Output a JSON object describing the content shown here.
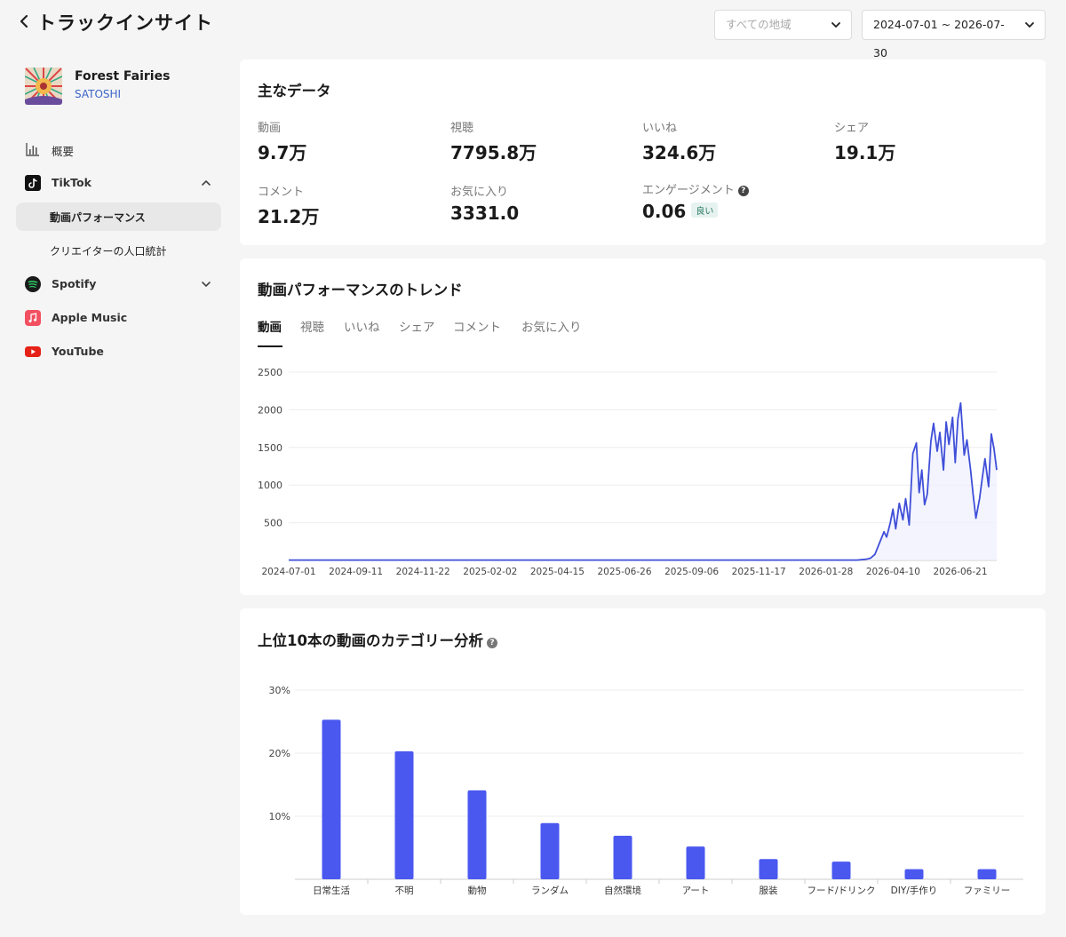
{
  "header": {
    "title": "トラックインサイト",
    "region_placeholder": "すべての地域",
    "date_range": "2024-07-01 ~ 2026-07-30"
  },
  "track": {
    "title": "Forest Fairies",
    "artist": "SATOSHI"
  },
  "sidebar": {
    "overview": "概要",
    "tiktok": "TikTok",
    "tiktok_sub": [
      "動画パフォーマンス",
      "クリエイターの人口統計"
    ],
    "spotify": "Spotify",
    "apple_music": "Apple Music",
    "youtube": "YouTube"
  },
  "key_data": {
    "title": "主なデータ",
    "items": [
      {
        "label": "動画",
        "value": "9.7万"
      },
      {
        "label": "視聴",
        "value": "7795.8万"
      },
      {
        "label": "いいね",
        "value": "324.6万"
      },
      {
        "label": "シェア",
        "value": "19.1万"
      },
      {
        "label": "コメント",
        "value": "21.2万"
      },
      {
        "label": "お気に入り",
        "value": "3331.0"
      },
      {
        "label": "エンゲージメント",
        "value": "0.06",
        "badge": "良い"
      }
    ]
  },
  "trend": {
    "title": "動画パフォーマンスのトレンド",
    "tabs": [
      "動画",
      "視聴",
      "いいね",
      "シェア",
      "コメント",
      "お気に入り"
    ],
    "active_tab": 0
  },
  "category": {
    "title": "上位10本の動画のカテゴリー分析"
  },
  "colors": {
    "accent": "#4a58f0",
    "line": "#3f4fd8"
  },
  "chart_data": [
    {
      "type": "line",
      "series": [
        {
          "values": [
            [
              0,
              5
            ],
            [
              60,
              5
            ],
            [
              120,
              5
            ],
            [
              180,
              5
            ],
            [
              240,
              5
            ],
            [
              300,
              5
            ],
            [
              360,
              5
            ],
            [
              420,
              5
            ],
            [
              480,
              5
            ],
            [
              540,
              5
            ],
            [
              600,
              5
            ],
            [
              630,
              5
            ],
            [
              640,
              15
            ],
            [
              645,
              30
            ],
            [
              650,
              80
            ],
            [
              655,
              230
            ],
            [
              660,
              380
            ],
            [
              663,
              310
            ],
            [
              667,
              500
            ],
            [
              670,
              680
            ],
            [
              673,
              420
            ],
            [
              677,
              760
            ],
            [
              681,
              540
            ],
            [
              684,
              820
            ],
            [
              688,
              470
            ],
            [
              692,
              1420
            ],
            [
              696,
              1560
            ],
            [
              699,
              900
            ],
            [
              702,
              1200
            ],
            [
              705,
              740
            ],
            [
              708,
              880
            ],
            [
              712,
              1580
            ],
            [
              715,
              1820
            ],
            [
              719,
              1450
            ],
            [
              722,
              1700
            ],
            [
              726,
              1200
            ],
            [
              729,
              1840
            ],
            [
              732,
              1540
            ],
            [
              736,
              1900
            ],
            [
              739,
              1300
            ],
            [
              742,
              1880
            ],
            [
              745,
              2090
            ],
            [
              749,
              1400
            ],
            [
              752,
              1600
            ],
            [
              756,
              1200
            ],
            [
              759,
              860
            ],
            [
              762,
              560
            ],
            [
              766,
              820
            ],
            [
              769,
              1100
            ],
            [
              772,
              1350
            ],
            [
              776,
              980
            ],
            [
              779,
              1680
            ],
            [
              782,
              1480
            ],
            [
              785,
              1200
            ]
          ]
        }
      ],
      "x_ticks": [
        "2024-07-01",
        "2024-09-11",
        "2024-11-22",
        "2025-02-02",
        "2025-04-15",
        "2025-06-26",
        "2025-09-06",
        "2025-11-17",
        "2026-01-28",
        "2026-04-10",
        "2026-06-21"
      ],
      "y_ticks": [
        500,
        1000,
        1500,
        2000,
        2500
      ],
      "ylim": [
        0,
        2500
      ],
      "grid": true
    },
    {
      "type": "bar",
      "categories": [
        "日常生活",
        "不明",
        "動物",
        "ランダム",
        "自然環境",
        "アート",
        "服装",
        "フード/ドリンク",
        "DIY/手作り",
        "ファミリー"
      ],
      "values": [
        25.3,
        20.3,
        14.1,
        8.9,
        6.9,
        5.2,
        3.2,
        2.8,
        1.6,
        1.6
      ],
      "y_ticks": [
        "10%",
        "20%",
        "30%"
      ],
      "ylim": [
        0,
        30
      ],
      "grid": true
    }
  ]
}
